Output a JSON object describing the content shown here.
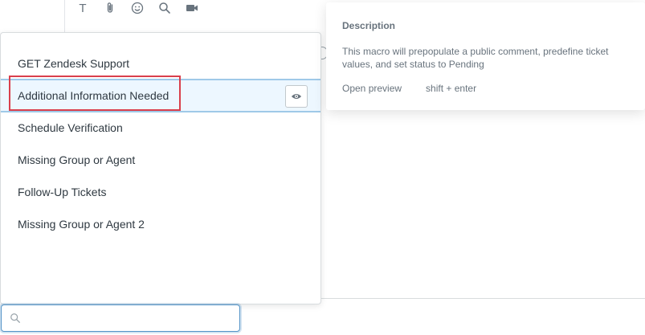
{
  "toolbar": {
    "text_icon": "T",
    "icons": [
      "text-format-icon",
      "attachment-icon",
      "emoji-icon",
      "search-icon",
      "video-icon"
    ]
  },
  "macros": {
    "items": [
      {
        "label": "GET Zendesk Support"
      },
      {
        "label": "Additional Information Needed"
      },
      {
        "label": "Schedule Verification"
      },
      {
        "label": "Missing Group or Agent"
      },
      {
        "label": "Follow-Up Tickets"
      },
      {
        "label": "Missing Group or Agent 2"
      }
    ],
    "active_index": 1
  },
  "description": {
    "title": "Description",
    "text": "This macro will prepopulate a public comment, predefine ticket values, and set status to Pending",
    "open_preview": "Open preview",
    "shortcut": "shift + enter"
  },
  "search": {
    "value": "",
    "placeholder": ""
  },
  "colors": {
    "highlight": "#d93f4c",
    "active_bg": "#edf7ff",
    "active_border": "#9fc9e8",
    "text": "#2f3941",
    "muted": "#68737d"
  }
}
